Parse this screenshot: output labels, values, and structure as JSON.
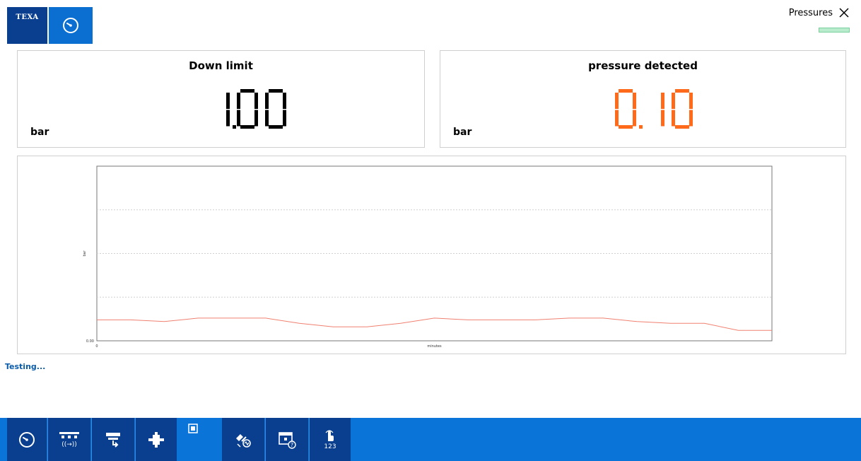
{
  "header": {
    "logo_text": "TEXA",
    "mode_icon": "gauge-icon",
    "tab_title": "Pressures",
    "status_color": "#b9eccd"
  },
  "panels": {
    "down_limit": {
      "title": "Down limit",
      "value": "1.00",
      "unit": "bar",
      "color": "#000000"
    },
    "pressure_detected": {
      "title": "pressure detected",
      "value": "0.10",
      "unit": "bar",
      "color": "#ff6a1a"
    }
  },
  "chart_data": {
    "type": "line",
    "xlabel": "minutes",
    "ylabel": "bar",
    "x_tick_labels": [
      "0"
    ],
    "y_tick_labels": [
      "0.00"
    ],
    "grid": true,
    "series": [
      {
        "color": "#f08070",
        "x": [
          0,
          1,
          2,
          3,
          4,
          5,
          6,
          7,
          8,
          9,
          10,
          11,
          12,
          13,
          14,
          15,
          16,
          17,
          18,
          19,
          20
        ],
        "y": [
          0.12,
          0.12,
          0.11,
          0.13,
          0.13,
          0.13,
          0.1,
          0.08,
          0.08,
          0.1,
          0.13,
          0.12,
          0.12,
          0.12,
          0.13,
          0.13,
          0.11,
          0.1,
          0.1,
          0.06,
          0.06
        ]
      }
    ]
  },
  "status": {
    "text": "Testing..."
  },
  "toolbar": {
    "buttons": [
      {
        "icon": "gauge-icon"
      },
      {
        "icon": "signal-transfer-icon",
        "label": "((→))"
      },
      {
        "icon": "clamp-icon"
      },
      {
        "icon": "component-icon"
      },
      {
        "icon": "stop-icon"
      },
      {
        "icon": "sensor-signal-icon"
      },
      {
        "icon": "calendar-help-icon"
      },
      {
        "icon": "hand-numeric-icon",
        "label": "123"
      }
    ]
  }
}
